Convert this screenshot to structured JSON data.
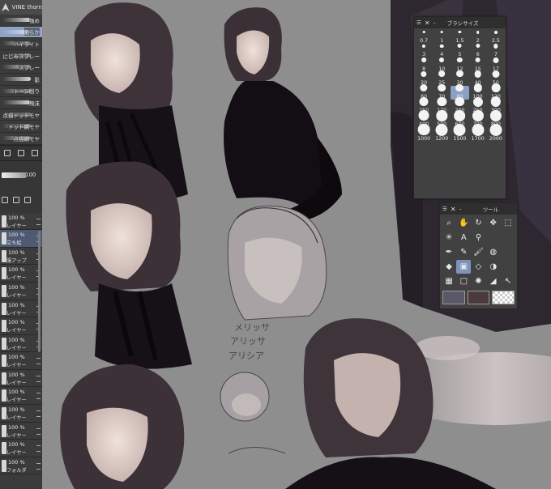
{
  "brush_set": {
    "name": "VINE thorn"
  },
  "brushes": [
    {
      "label": "強め"
    },
    {
      "label": "柔らか"
    },
    {
      "label": "ハイライト"
    },
    {
      "label": "にじみスプレー"
    },
    {
      "label": "スプレー"
    },
    {
      "label": "影"
    },
    {
      "label": "トーン削り"
    },
    {
      "label": "飛沫"
    },
    {
      "label": "点描ドットモヤ"
    },
    {
      "label": "ドット網モヤ"
    },
    {
      "label": "点描網モヤ"
    }
  ],
  "layer_props": {
    "opacity": "100"
  },
  "layers": [
    {
      "pct": "100 %",
      "name": "レイヤー"
    },
    {
      "pct": "100 %",
      "name": "立ち絵"
    },
    {
      "pct": "100 %",
      "name": "服アップ"
    },
    {
      "pct": "100 %",
      "name": "レイヤー"
    },
    {
      "pct": "100 %",
      "name": "レイヤー"
    },
    {
      "pct": "100 %",
      "name": "レイヤー"
    },
    {
      "pct": "100 %",
      "name": "レイヤー"
    },
    {
      "pct": "100 %",
      "name": "レイヤー"
    },
    {
      "pct": "100 %",
      "name": "レイヤー"
    },
    {
      "pct": "100 %",
      "name": "レイヤー"
    },
    {
      "pct": "100 %",
      "name": "レイヤー"
    },
    {
      "pct": "100 %",
      "name": "レイヤー"
    },
    {
      "pct": "100 %",
      "name": "レイヤー"
    },
    {
      "pct": "100 %",
      "name": "レイヤー"
    },
    {
      "pct": "100 %",
      "name": "フォルダ"
    }
  ],
  "brush_size_palette": {
    "title": "ブラシサイズ",
    "sizes": [
      "0.7",
      "1",
      "1.5",
      "2",
      "2.5",
      "3",
      "4",
      "5",
      "6",
      "7",
      "8",
      "10",
      "12",
      "15",
      "17",
      "20",
      "25",
      "30",
      "40",
      "50",
      "60",
      "70",
      "80",
      "100",
      "120",
      "150",
      "170",
      "200",
      "250",
      "300",
      "400",
      "500",
      "600",
      "700",
      "800",
      "1000",
      "1200",
      "1500",
      "1700",
      "2000"
    ],
    "selected": "80"
  },
  "tool_palette": {
    "title": "ツール",
    "colors": {
      "main": "#5a5866",
      "sub": "#4a3a3c"
    }
  },
  "sketch_text": [
    "メリッサ",
    "アリッサ",
    "アリシア"
  ]
}
